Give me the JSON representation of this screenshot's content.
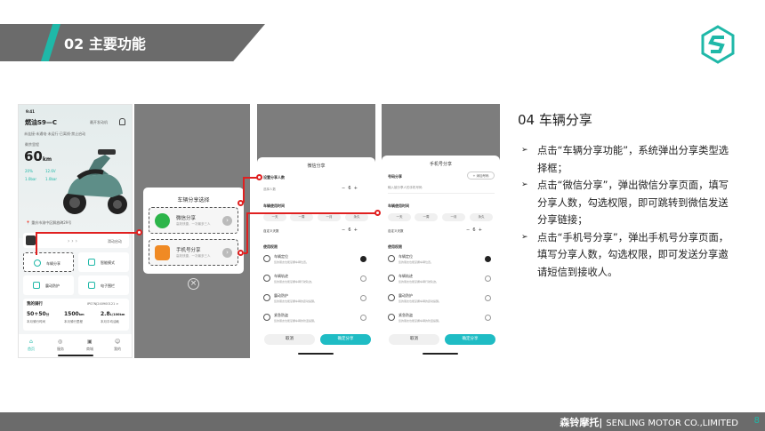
{
  "header": {
    "title": "02 主要功能"
  },
  "footer": {
    "brand_cn": "森铃摩托",
    "brand_en": "SENLING MOTOR CO.,LIMITED",
    "page": "8"
  },
  "section": {
    "title": "04 车辆分享",
    "bullets": [
      "点击“车辆分享功能”，系统弹出分享类型选择框；",
      "点击“微信分享”，弹出微信分享页面，填写分享人数，勾选权限，即可跳转到微信发送分享链接；",
      "点击“手机号分享”，弹出手机号分享页面，填写分享人数，勾选权限，即可发送分享邀请短信到接收人。"
    ]
  },
  "phone1": {
    "time": "9:41",
    "model": "燃油S9—C",
    "status": "最开发动机",
    "tags": [
      "未连接",
      "未通电",
      "未运行",
      "已离线",
      "禁止启动"
    ],
    "fuel_label": "剩余里程",
    "range": "60",
    "range_unit": "km",
    "stat1": "20%",
    "stat2": "12.6V",
    "stat3": "1.0bar",
    "stat4": "1.0bar",
    "location": "重庆市渝中区解放碑29号",
    "slide_label": "滑动启动",
    "features": [
      {
        "label": "车辆分享"
      },
      {
        "label": "智能模式"
      },
      {
        "label": "震动防护"
      },
      {
        "label": "电子围栏"
      }
    ],
    "trip_title": "我的骑行",
    "trip_id": "IPS7NJ240900121 >",
    "trip_values": [
      {
        "value": "50+50",
        "unit": "分",
        "label": "本月骑行时间"
      },
      {
        "value": "1500",
        "unit": "km",
        "label": "本月骑行里程"
      },
      {
        "value": "2.8",
        "unit": "L/100km",
        "label": "本月平均油耗"
      }
    ],
    "nav": [
      "首页",
      "服务",
      "商城",
      "我的"
    ]
  },
  "dialog_share": {
    "title": "车辆分享选择",
    "options": [
      {
        "title": "微信分享",
        "sub": "高效快捷，一次最多三人"
      },
      {
        "title": "手机号分享",
        "sub": "高效快捷，一次最多三人"
      }
    ],
    "close": "×"
  },
  "wechat_sheet": {
    "title": "微信分享",
    "count_label": "设置分享人数",
    "count_sub": "选择人数",
    "count_value": "6",
    "time_label": "车辆使用时间",
    "time_options": [
      "一天",
      "一周",
      "一月",
      "永久"
    ],
    "custom_label": "自定义天数",
    "custom_value": "6",
    "perm_label": "使用权限",
    "perms": [
      {
        "title": "车辆定位",
        "desc": "您的朋友也能掌握车辆位置。",
        "on": true
      },
      {
        "title": "车辆轨迹",
        "desc": "您的朋友也能掌握车辆行驶轨迹。",
        "on": false
      },
      {
        "title": "震动防护",
        "desc": "您的朋友也能掌握车辆的震动提醒。",
        "on": false
      },
      {
        "title": "紧急防盗",
        "desc": "您的朋友也能掌握车辆的防盗提醒。",
        "on": false
      }
    ],
    "cancel": "取消",
    "confirm": "确定分享"
  },
  "phone_sheet": {
    "title": "手机号分享",
    "phone_label": "号码分享",
    "add_contact": "+ 添加号码",
    "phone_placeholder": "输入被分享人的手机号码",
    "time_label": "车辆使用时间",
    "time_options": [
      "一天",
      "一周",
      "一月",
      "永久"
    ],
    "custom_label": "自定义天数",
    "custom_value": "6",
    "perm_label": "使用权限",
    "perms": [
      {
        "title": "车辆定位",
        "desc": "您的朋友也能掌握车辆位置。",
        "on": true
      },
      {
        "title": "车辆轨迹",
        "desc": "您的朋友也能掌握车辆行驶轨迹。",
        "on": false
      },
      {
        "title": "震动防护",
        "desc": "您的朋友也能掌握车辆的震动提醒。",
        "on": false
      },
      {
        "title": "紧急防盗",
        "desc": "您的朋友也能掌握车辆的防盗提醒。",
        "on": false
      }
    ],
    "cancel": "取消",
    "confirm": "确定分享"
  },
  "colors": {
    "accent": "#1fb8a8",
    "red": "#e02020",
    "banner": "#6b6b6b"
  }
}
